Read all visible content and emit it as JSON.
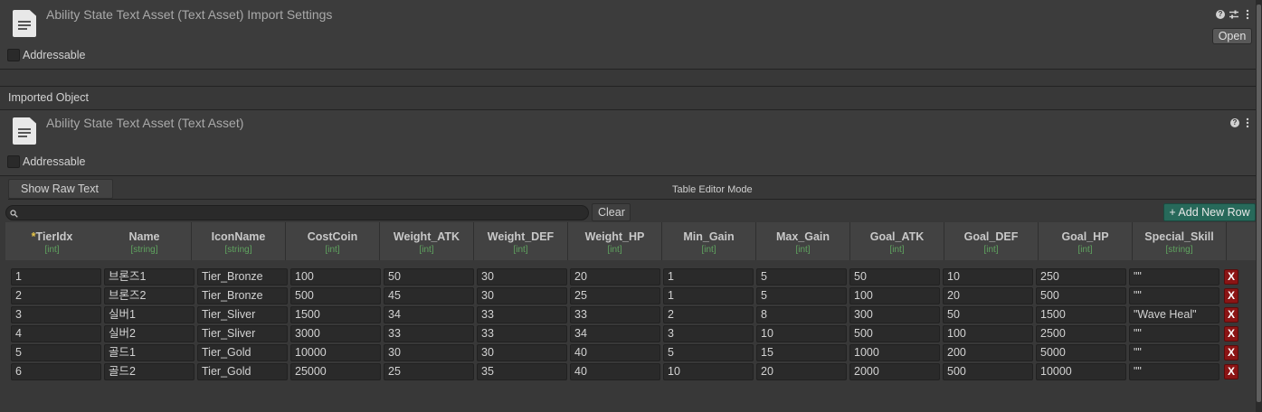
{
  "import_settings": {
    "title": "Ability State Text Asset (Text Asset) Import Settings",
    "open_label": "Open",
    "help_icon": "help-icon",
    "settings_icon": "sliders-icon",
    "more_icon": "more-icon",
    "addressable_label": "Addressable"
  },
  "imported_object_label": "Imported Object",
  "asset": {
    "title": "Ability State Text Asset (Text Asset)",
    "addressable_label": "Addressable"
  },
  "editor": {
    "show_raw_text_label": "Show Raw Text",
    "mode_label": "Table Editor Mode",
    "search_placeholder": "",
    "clear_label": "Clear",
    "add_row_label": "+ Add New Row"
  },
  "table": {
    "columns": [
      {
        "name": "TierIdx",
        "type": "[int]",
        "required_marker": "*"
      },
      {
        "name": "Name",
        "type": "[string]"
      },
      {
        "name": "IconName",
        "type": "[string]"
      },
      {
        "name": "CostCoin",
        "type": "[int]"
      },
      {
        "name": "Weight_ATK",
        "type": "[int]"
      },
      {
        "name": "Weight_DEF",
        "type": "[int]"
      },
      {
        "name": "Weight_HP",
        "type": "[int]"
      },
      {
        "name": "Min_Gain",
        "type": "[int]"
      },
      {
        "name": "Max_Gain",
        "type": "[int]"
      },
      {
        "name": "Goal_ATK",
        "type": "[int]"
      },
      {
        "name": "Goal_DEF",
        "type": "[int]"
      },
      {
        "name": "Goal_HP",
        "type": "[int]"
      },
      {
        "name": "Special_Skill",
        "type": "[string]"
      }
    ],
    "rows": [
      [
        "1",
        "브론즈1",
        "Tier_Bronze",
        "100",
        "50",
        "30",
        "20",
        "1",
        "5",
        "50",
        "10",
        "250",
        "\"\""
      ],
      [
        "2",
        "브론즈2",
        "Tier_Bronze",
        "500",
        "45",
        "30",
        "25",
        "1",
        "5",
        "100",
        "20",
        "500",
        "\"\""
      ],
      [
        "3",
        "실버1",
        "Tier_Sliver",
        "1500",
        "34",
        "33",
        "33",
        "2",
        "8",
        "300",
        "50",
        "1500",
        "\"Wave Heal\""
      ],
      [
        "4",
        "실버2",
        "Tier_Sliver",
        "3000",
        "33",
        "33",
        "34",
        "3",
        "10",
        "500",
        "100",
        "2500",
        "\"\""
      ],
      [
        "5",
        "골드1",
        "Tier_Gold",
        "10000",
        "30",
        "30",
        "40",
        "5",
        "15",
        "1000",
        "200",
        "5000",
        "\"\""
      ],
      [
        "6",
        "골드2",
        "Tier_Gold",
        "25000",
        "25",
        "35",
        "40",
        "10",
        "20",
        "2000",
        "500",
        "10000",
        "\"\""
      ]
    ],
    "delete_label": "X"
  },
  "colors": {
    "background": "#383838",
    "type_label": "#5fa35f",
    "required_marker": "#e5c549",
    "delete_button": "#8b1414",
    "add_row_button": "#27695a"
  }
}
